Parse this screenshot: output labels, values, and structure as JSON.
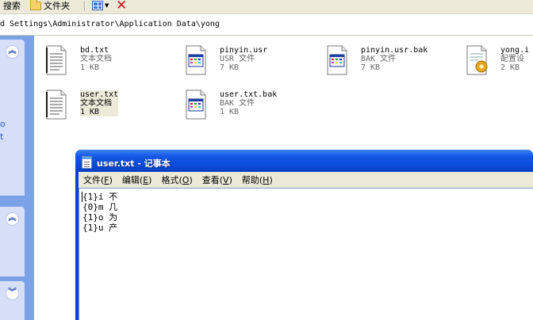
{
  "toolbar": {
    "search_label": "搜索",
    "folders_label": "文件夹",
    "views_icon": "views-grid-icon",
    "delete_icon": "delete-x-icon"
  },
  "address": {
    "path": "d Settings\\Administrator\\Application Data\\yong"
  },
  "task_pane": {
    "links": [
      "o",
      "t"
    ]
  },
  "files": [
    {
      "name": "bd.txt",
      "type": "文本文档",
      "size": "1 KB",
      "icon": "text-document-icon"
    },
    {
      "name": "pinyin.usr",
      "type": "USR 文件",
      "size": "7 KB",
      "icon": "generic-file-icon"
    },
    {
      "name": "pinyin.usr.bak",
      "type": "BAK 文件",
      "size": "7 KB",
      "icon": "generic-file-icon"
    },
    {
      "name": "yong.i",
      "type": "配置设",
      "size": "2 KB",
      "icon": "config-settings-icon"
    },
    {
      "name": "user.txt",
      "type": "文本文档",
      "size": "1 KB",
      "icon": "text-document-icon"
    },
    {
      "name": "user.txt.bak",
      "type": "BAK 文件",
      "size": "1 KB",
      "icon": "generic-file-icon"
    }
  ],
  "notepad": {
    "title": "user.txt - 记事本",
    "menu": [
      {
        "label": "文件",
        "accel": "F"
      },
      {
        "label": "编辑",
        "accel": "E"
      },
      {
        "label": "格式",
        "accel": "O"
      },
      {
        "label": "查看",
        "accel": "V"
      },
      {
        "label": "帮助",
        "accel": "H"
      }
    ],
    "lines": [
      "{1}i 不",
      "{0}m 几",
      "{1}o 为",
      "{1}u 产"
    ]
  },
  "colors": {
    "titlebar_blue": "#0a4ad8",
    "task_pane_blue": "#7ba2e7",
    "delete_red": "#d0121a"
  }
}
